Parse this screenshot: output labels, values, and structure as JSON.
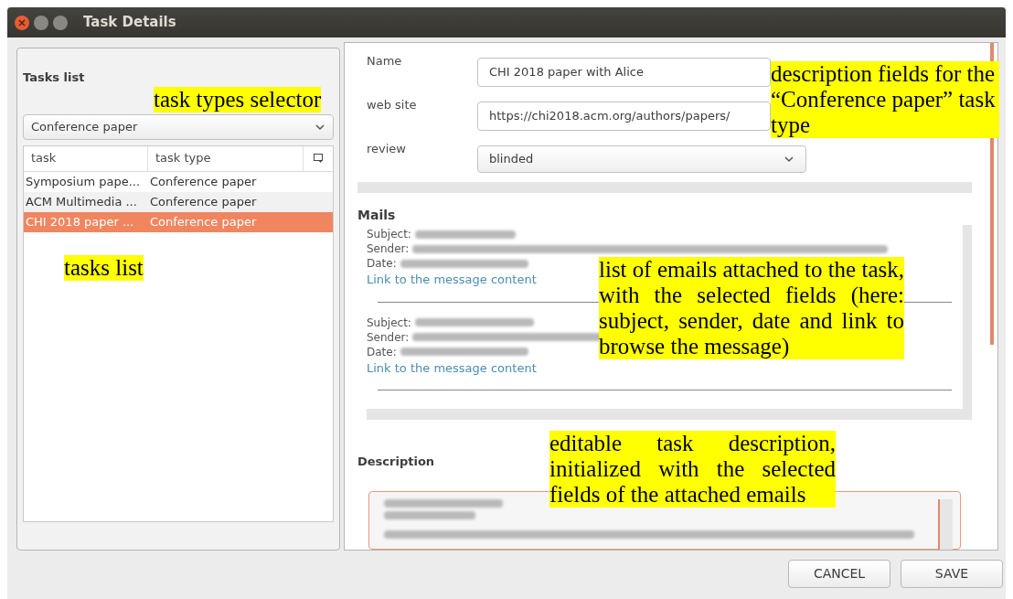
{
  "window": {
    "title": "Task Details"
  },
  "tasks_panel": {
    "title": "Tasks list",
    "type_selector": {
      "value": "Conference paper"
    },
    "table": {
      "columns": [
        "task",
        "task type"
      ],
      "rows": [
        {
          "task": "Symposium pape...",
          "task_type": "Conference paper",
          "selected": false
        },
        {
          "task": "ACM Multimedia ...",
          "task_type": "Conference paper",
          "selected": false
        },
        {
          "task": "CHI 2018 paper ...",
          "task_type": "Conference paper",
          "selected": true
        }
      ]
    }
  },
  "details": {
    "fields": [
      {
        "kind": "text",
        "label": "Name",
        "value": "CHI 2018 paper with Alice"
      },
      {
        "kind": "text",
        "label": "web site",
        "value": "https://chi2018.acm.org/authors/papers/"
      },
      {
        "kind": "select",
        "label": "review",
        "value": "blinded"
      }
    ],
    "mails_title": "Mails",
    "mails": [
      {
        "subject_label": "Subject:",
        "sender_label": "Sender:",
        "date_label": "Date:",
        "link": "Link to the message content"
      },
      {
        "subject_label": "Subject:",
        "sender_label": "Sender:",
        "date_label": "Date:",
        "link": "Link to the message content"
      }
    ],
    "description_title": "Description"
  },
  "buttons": [
    "CANCEL",
    "SAVE"
  ],
  "annotations": [
    "task types selector",
    "tasks list",
    "description fields for the “Conference paper” task type",
    "list of emails attached to the task, with the selected fields (here: subject, sender, date and link to browse the message)",
    "editable task description, initialized with the selected fields of the attached emails"
  ]
}
